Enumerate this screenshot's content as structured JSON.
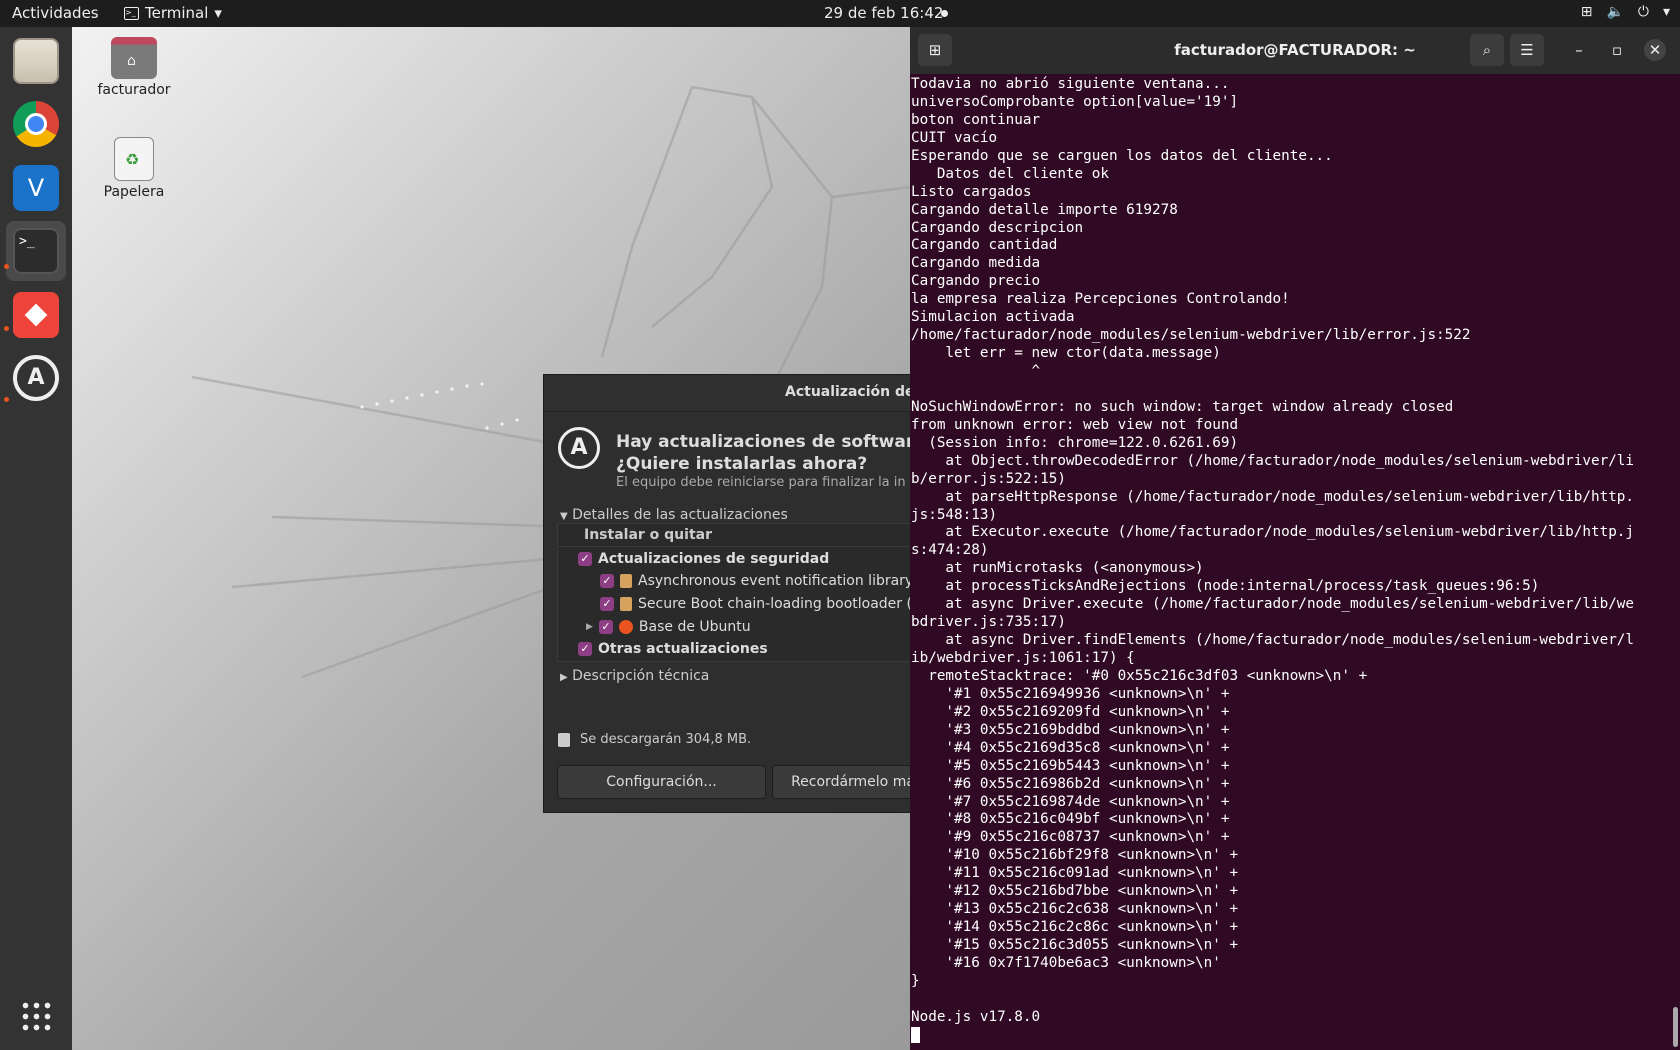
{
  "topbar": {
    "activities": "Actividades",
    "app_name": "Terminal",
    "clock": "29 de feb  16:42"
  },
  "dock": {
    "items": [
      "Files",
      "Google Chrome",
      "VNC Viewer",
      "Terminal",
      "AnyDesk",
      "Software Updater"
    ],
    "apps_grid_icon": "apps-grid-icon"
  },
  "desktop": {
    "icons": [
      {
        "label": "facturador",
        "icon": "home-folder-icon"
      },
      {
        "label": "Papelera",
        "icon": "trash-icon"
      }
    ]
  },
  "update_dialog": {
    "title": "Actualización de s",
    "headline_1": "Hay actualizaciones de software di",
    "headline_2": "¿Quiere instalarlas ahora?",
    "subtitle": "El equipo debe reiniciarse para finalizar la in",
    "details_label": "Detalles de las actualizaciones",
    "column_header": "Instalar o quitar",
    "rows": [
      {
        "label": "Actualizaciones de seguridad",
        "checked": true
      },
      {
        "label": "Asynchronous event notification library -",
        "checked": true
      },
      {
        "label": "Secure Boot chain-loading bootloader (N",
        "checked": true
      },
      {
        "label": "Base de Ubuntu",
        "checked": true
      },
      {
        "label": "Otras actualizaciones",
        "checked": true
      }
    ],
    "tech_label": "Descripción técnica",
    "download_size": "Se descargarán 304,8 MB.",
    "btn_settings": "Configuración...",
    "btn_remind": "Recordármelo má"
  },
  "terminal": {
    "title": "facturador@FACTURADOR: ~",
    "lines": [
      "Todavia no abrió siguiente ventana...",
      "universoComprobante option[value='19']",
      "boton continuar",
      "CUIT vacío",
      "Esperando que se carguen los datos del cliente...",
      "   Datos del cliente ok",
      "Listo cargados",
      "Cargando detalle importe 619278",
      "Cargando descripcion",
      "Cargando cantidad",
      "Cargando medida",
      "Cargando precio",
      "la empresa realiza Percepciones Controlando!",
      "Simulacion activada",
      "/home/facturador/node_modules/selenium-webdriver/lib/error.js:522",
      "    let err = new ctor(data.message)",
      "              ^",
      "",
      "NoSuchWindowError: no such window: target window already closed",
      "from unknown error: web view not found",
      "  (Session info: chrome=122.0.6261.69)",
      "    at Object.throwDecodedError (/home/facturador/node_modules/selenium-webdriver/li",
      "b/error.js:522:15)",
      "    at parseHttpResponse (/home/facturador/node_modules/selenium-webdriver/lib/http.",
      "js:548:13)",
      "    at Executor.execute (/home/facturador/node_modules/selenium-webdriver/lib/http.j",
      "s:474:28)",
      "    at runMicrotasks (<anonymous>)",
      "    at processTicksAndRejections (node:internal/process/task_queues:96:5)",
      "    at async Driver.execute (/home/facturador/node_modules/selenium-webdriver/lib/we",
      "bdriver.js:735:17)",
      "    at async Driver.findElements (/home/facturador/node_modules/selenium-webdriver/l",
      "ib/webdriver.js:1061:17) {",
      "  remoteStacktrace: '#0 0x55c216c3df03 <unknown>\\n' +",
      "    '#1 0x55c216949936 <unknown>\\n' +",
      "    '#2 0x55c2169209fd <unknown>\\n' +",
      "    '#3 0x55c2169bddbd <unknown>\\n' +",
      "    '#4 0x55c2169d35c8 <unknown>\\n' +",
      "    '#5 0x55c2169b5443 <unknown>\\n' +",
      "    '#6 0x55c216986b2d <unknown>\\n' +",
      "    '#7 0x55c2169874de <unknown>\\n' +",
      "    '#8 0x55c216c049bf <unknown>\\n' +",
      "    '#9 0x55c216c08737 <unknown>\\n' +",
      "    '#10 0x55c216bf29f8 <unknown>\\n' +",
      "    '#11 0x55c216c091ad <unknown>\\n' +",
      "    '#12 0x55c216bd7bbe <unknown>\\n' +",
      "    '#13 0x55c216c2c638 <unknown>\\n' +",
      "    '#14 0x55c216c2c86c <unknown>\\n' +",
      "    '#15 0x55c216c3d055 <unknown>\\n' +",
      "    '#16 0x7f1740be6ac3 <unknown>\\n'",
      "}",
      "",
      "Node.js v17.8.0"
    ]
  },
  "colors": {
    "terminal_bg": "#300a24",
    "topbar_bg": "#1d1d1d",
    "dock_bg": "#333333",
    "ubuntu_orange": "#e95420",
    "checkbox_purple": "#8e3e84"
  }
}
